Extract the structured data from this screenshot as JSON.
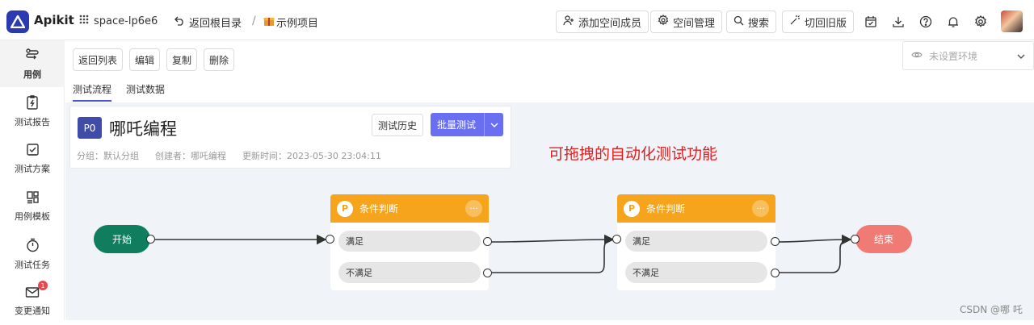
{
  "header": {
    "brand": "Apikit",
    "space": "space-lp6e6",
    "back_root": "返回根目录",
    "separator": "/",
    "project": "示例项目",
    "add_member": "添加空间成员",
    "space_manage": "空间管理",
    "search": "搜索",
    "switch_old": "切回旧版"
  },
  "sidebar": {
    "items": [
      {
        "label": "用例",
        "icon": "flow-icon"
      },
      {
        "label": "测试报告",
        "icon": "report-icon"
      },
      {
        "label": "测试方案",
        "icon": "plan-icon"
      },
      {
        "label": "用例模板",
        "icon": "template-icon"
      },
      {
        "label": "测试任务",
        "icon": "timer-icon"
      },
      {
        "label": "变更通知",
        "icon": "mail-icon",
        "badge": "1"
      }
    ]
  },
  "actions": {
    "back_list": "返回列表",
    "edit": "编辑",
    "copy": "复制",
    "delete": "删除"
  },
  "env": {
    "placeholder": "未设置环境"
  },
  "tabs": [
    "测试流程",
    "测试数据"
  ],
  "case": {
    "priority": "P0",
    "title": "哪吒编程",
    "history": "测试历史",
    "batch": "批量测试",
    "group": "分组：默认分组",
    "creator": "创建者：哪吒编程",
    "updated": "更新时间：2023-05-30 23:04:11"
  },
  "annotation": "可拖拽的自动化测试功能",
  "flow": {
    "start": "开始",
    "end": "结束",
    "conditions": [
      {
        "title": "条件判断",
        "yes": "满足",
        "no": "不满足"
      },
      {
        "title": "条件判断",
        "yes": "满足",
        "no": "不满足"
      }
    ]
  },
  "watermark": "CSDN @哪 吒",
  "colors": {
    "brand": "#2b3ab0",
    "primary_button": "#6a6ef0",
    "condition_header": "#f5a41b",
    "start_node": "#0f7d5e",
    "end_node": "#f07b75",
    "annotation": "#e02020"
  }
}
